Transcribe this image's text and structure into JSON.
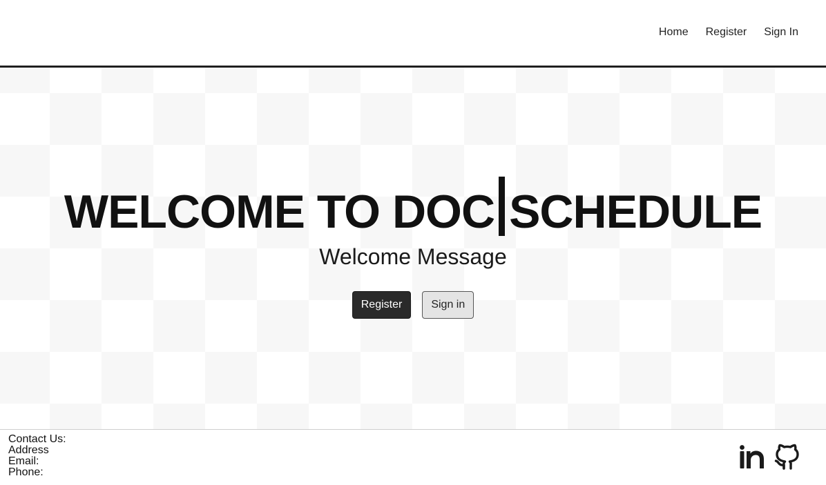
{
  "nav": {
    "links": [
      "Home",
      "Register",
      "Sign In"
    ]
  },
  "hero": {
    "title_left": "WELCOME TO DOC",
    "title_right": "SCHEDULE",
    "subtitle": "Welcome Message",
    "register_label": "Register",
    "signin_label": "Sign in"
  },
  "footer": {
    "contact_heading": "Contact Us:",
    "address_label": "Address",
    "email_label": "Email:",
    "phone_label": "Phone:",
    "social_icons": [
      "linkedin-icon",
      "github-icon"
    ]
  },
  "colors": {
    "primary_button": "#2a2a2a",
    "secondary_button": "#e4e4e4",
    "text": "#111111"
  }
}
